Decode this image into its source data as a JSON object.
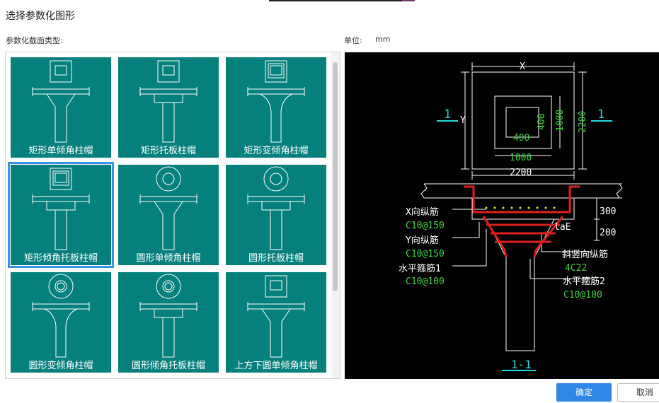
{
  "dialog": {
    "title": "选择参数化图形"
  },
  "gallery": {
    "label": "参数化截面类型:",
    "selected_index": 3,
    "items": [
      {
        "label": "矩形单倾角柱帽",
        "icon": "rect-single-slope-cap-icon"
      },
      {
        "label": "矩形托板柱帽",
        "icon": "rect-drop-panel-cap-icon"
      },
      {
        "label": "矩形变倾角柱帽",
        "icon": "rect-variable-slope-cap-icon"
      },
      {
        "label": "矩形倾角托板柱帽",
        "icon": "rect-slope-drop-panel-cap-icon"
      },
      {
        "label": "圆形单倾角柱帽",
        "icon": "round-single-slope-cap-icon"
      },
      {
        "label": "圆形托板柱帽",
        "icon": "round-drop-panel-cap-icon"
      },
      {
        "label": "圆形变倾角柱帽",
        "icon": "round-variable-slope-cap-icon"
      },
      {
        "label": "圆形倾角托板柱帽",
        "icon": "round-slope-drop-panel-cap-icon"
      },
      {
        "label": "上方下圆单倾角柱帽",
        "icon": "square-top-round-bottom-cap-icon"
      }
    ]
  },
  "unit": {
    "label": "单位:",
    "value": "mm"
  },
  "preview": {
    "plan": {
      "dim_x": "X",
      "dim_y": "Y",
      "col_inner_w": "400",
      "col_inner_h": "400",
      "col_w": "1000",
      "col_h": "1000",
      "cap_w": "2200",
      "cap_h": "2200",
      "section_mark_left": "1",
      "section_mark_right": "1"
    },
    "section": {
      "x_rebar_label": "X向纵筋",
      "x_rebar_value": "C10@150",
      "y_rebar_label": "Y向纵筋",
      "y_rebar_value": "C10@150",
      "stirrup1_label": "水平箍筋1",
      "stirrup1_value": "C10@100",
      "slant_rebar_label": "斜竖向纵筋",
      "slant_rebar_value": "4C22",
      "stirrup2_label": "水平箍筋2",
      "stirrup2_value": "C10@100",
      "lae_label": "laE",
      "dim_300": "300",
      "dim_200": "200",
      "section_title": "1-1"
    },
    "colors": {
      "white": "#ffffff",
      "green": "#3fd13f",
      "cyan": "#1fd8e0",
      "red": "#e01e1e",
      "yellow": "#e8e020"
    }
  },
  "buttons": {
    "ok": "确定",
    "cancel": "取消"
  }
}
